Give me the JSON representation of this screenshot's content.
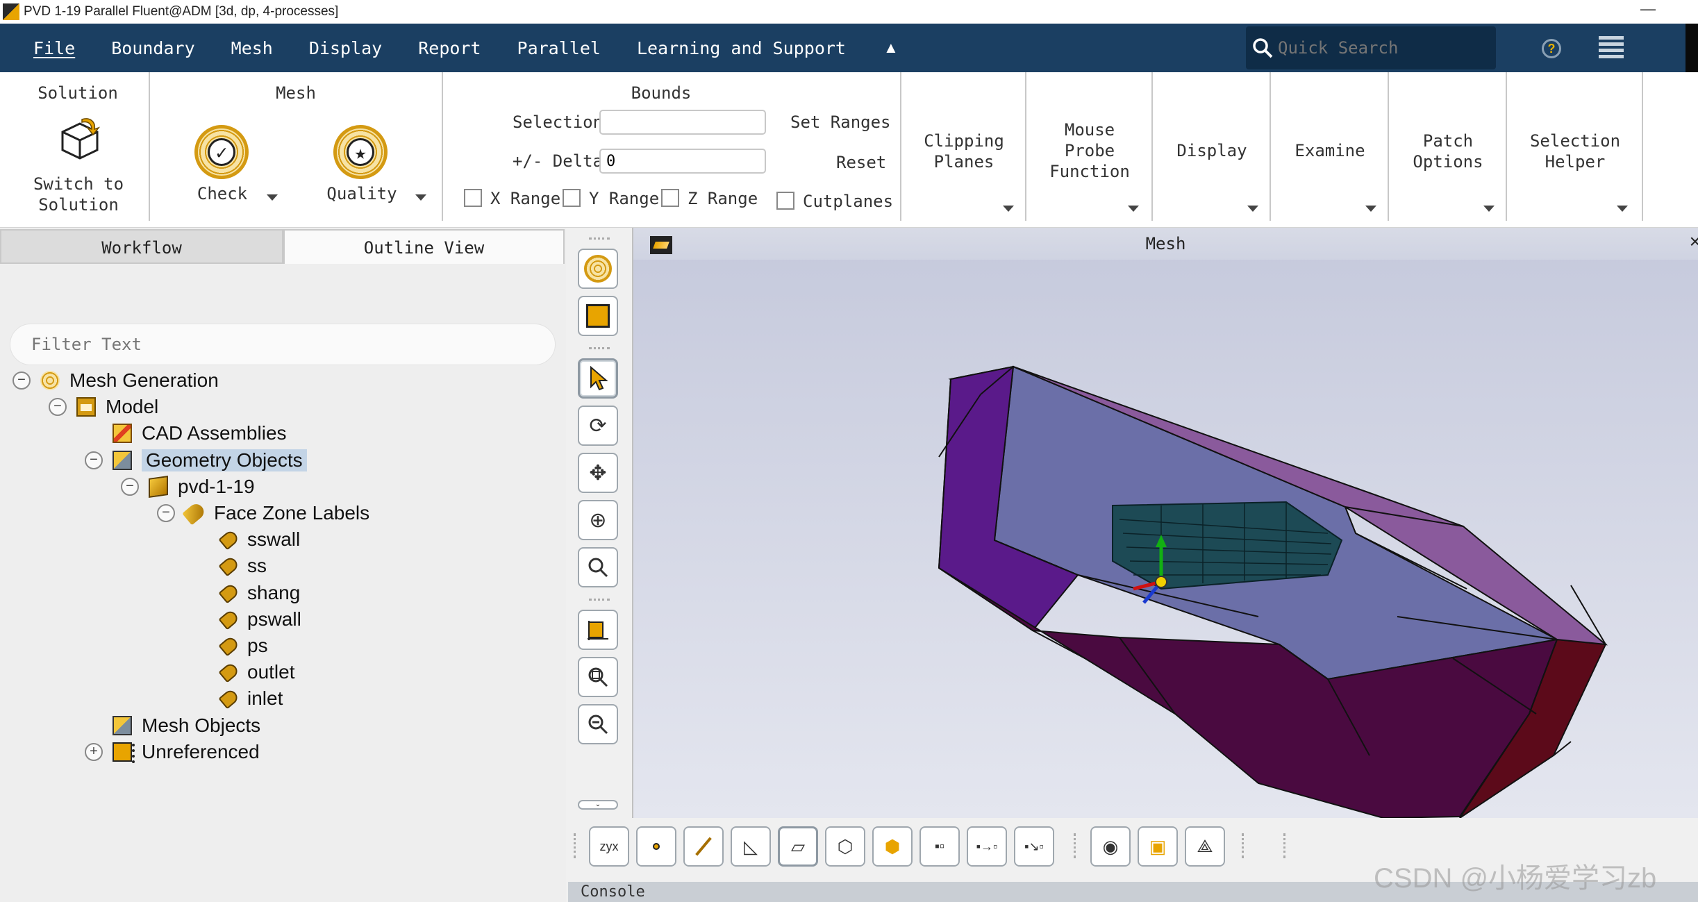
{
  "window": {
    "title": "PVD 1-19 Parallel Fluent@ADM  [3d, dp, 4-processes]",
    "minimize_glyph": "—"
  },
  "menubar": {
    "items": [
      "File",
      "Boundary",
      "Mesh",
      "Display",
      "Report",
      "Parallel",
      "Learning and Support"
    ],
    "collapse_icon": "caret-up-icon",
    "search_placeholder": "Quick Search",
    "help_glyph": "?"
  },
  "ribbon": {
    "solution": {
      "title": "Solution",
      "button_label": "Switch to\nSolution"
    },
    "mesh": {
      "title": "Mesh",
      "check_label": "Check",
      "quality_label": "Quality"
    },
    "bounds": {
      "title": "Bounds",
      "selection_label": "Selection",
      "selection_value": "",
      "delta_label": "+/- Delta",
      "delta_value": "0",
      "set_ranges": "Set Ranges",
      "reset": "Reset",
      "x_range": "X Range",
      "y_range": "Y Range",
      "z_range": "Z Range",
      "cutplanes": "Cutplanes"
    },
    "clipping_planes": "Clipping\nPlanes",
    "mouse_probe": "Mouse\nProbe\nFunction",
    "display": "Display",
    "examine": "Examine",
    "patch_options": "Patch\nOptions",
    "selection_helper": "Selection\nHelper"
  },
  "left_panel": {
    "tabs": [
      "Workflow",
      "Outline View"
    ],
    "active_tab": "Outline View",
    "filter_placeholder": "Filter Text",
    "tree": [
      {
        "label": "Mesh Generation",
        "level": 0,
        "toggle": "−",
        "icon": "mesh-generation-icon"
      },
      {
        "label": "Model",
        "level": 1,
        "toggle": "−",
        "icon": "model-icon"
      },
      {
        "label": "CAD Assemblies",
        "level": 2,
        "toggle": "",
        "icon": "cad-assemblies-icon"
      },
      {
        "label": "Geometry Objects",
        "level": 2,
        "toggle": "−",
        "icon": "geometry-objects-icon",
        "selected": true
      },
      {
        "label": "pvd-1-19",
        "level": 3,
        "toggle": "−",
        "icon": "geometry-object-icon"
      },
      {
        "label": "Face Zone Labels",
        "level": 4,
        "toggle": "−",
        "icon": "face-zone-labels-icon"
      },
      {
        "label": "sswall",
        "level": 5,
        "toggle": "",
        "icon": "label-tag-icon"
      },
      {
        "label": "ss",
        "level": 5,
        "toggle": "",
        "icon": "label-tag-icon"
      },
      {
        "label": "shang",
        "level": 5,
        "toggle": "",
        "icon": "label-tag-icon"
      },
      {
        "label": "pswall",
        "level": 5,
        "toggle": "",
        "icon": "label-tag-icon"
      },
      {
        "label": "ps",
        "level": 5,
        "toggle": "",
        "icon": "label-tag-icon"
      },
      {
        "label": "outlet",
        "level": 5,
        "toggle": "",
        "icon": "label-tag-icon"
      },
      {
        "label": "inlet",
        "level": 5,
        "toggle": "",
        "icon": "label-tag-icon"
      },
      {
        "label": "Mesh Objects",
        "level": 2,
        "toggle": "",
        "icon": "mesh-objects-icon"
      },
      {
        "label": "Unreferenced",
        "level": 2,
        "toggle": "+",
        "icon": "unreferenced-icon"
      }
    ]
  },
  "graphics": {
    "title": "Mesh",
    "close_glyph": "×",
    "colors": {
      "top_face": "#8a5a9c",
      "side_face": "#5a1a8a",
      "front_face": "#4a0a40",
      "inner_face": "#6b6fa8",
      "end_face": "#5c0a1a",
      "blade": "#1d4a55"
    }
  },
  "console": {
    "label": "Console"
  },
  "watermark": "CSDN @小杨爱学习zb"
}
